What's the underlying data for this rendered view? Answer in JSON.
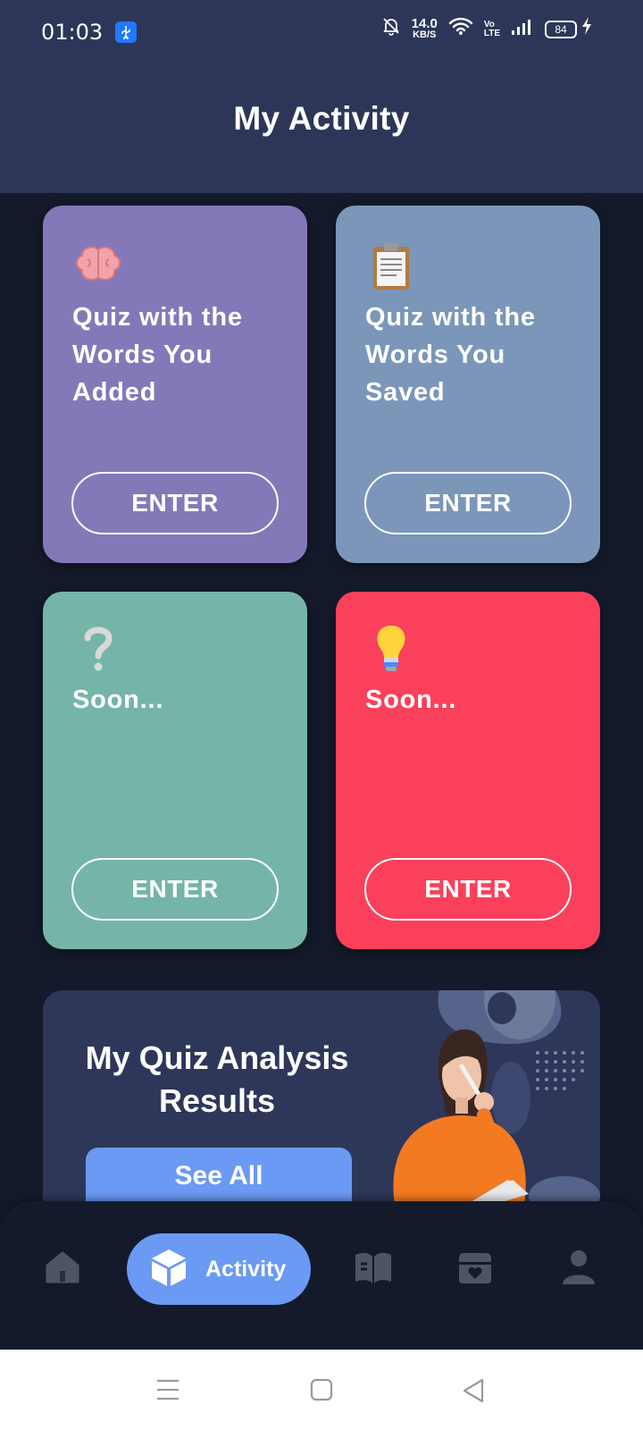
{
  "status_bar": {
    "time": "01:03",
    "net_speed_value": "14.0",
    "net_speed_unit": "KB/S",
    "volte": "Vo",
    "lte": "LTE",
    "battery": "84"
  },
  "header": {
    "title": "My Activity"
  },
  "cards": [
    {
      "icon": "brain-icon",
      "title": "Quiz with the Words You Added",
      "button": "ENTER",
      "color": "#8578b8"
    },
    {
      "icon": "clipboard-icon",
      "title": "Quiz with the Words You Saved",
      "button": "ENTER",
      "color": "#7b96b9"
    },
    {
      "icon": "question-mark-icon",
      "title": "Soon...",
      "button": "ENTER",
      "color": "#75b5a9"
    },
    {
      "icon": "light-bulb-icon",
      "title": "Soon...",
      "button": "ENTER",
      "color": "#fb405c"
    }
  ],
  "analysis": {
    "title": "My Quiz Analysis Results",
    "button": "See All"
  },
  "bottom_nav": {
    "items": [
      {
        "icon": "home-icon",
        "label": ""
      },
      {
        "icon": "cube-icon",
        "label": "Activity",
        "active": true
      },
      {
        "icon": "book-icon",
        "label": ""
      },
      {
        "icon": "folder-heart-icon",
        "label": ""
      },
      {
        "icon": "user-icon",
        "label": ""
      }
    ],
    "active_color": "#6a9af3"
  },
  "colors": {
    "header_bg": "#2d3658",
    "page_bg": "#141a2b"
  }
}
